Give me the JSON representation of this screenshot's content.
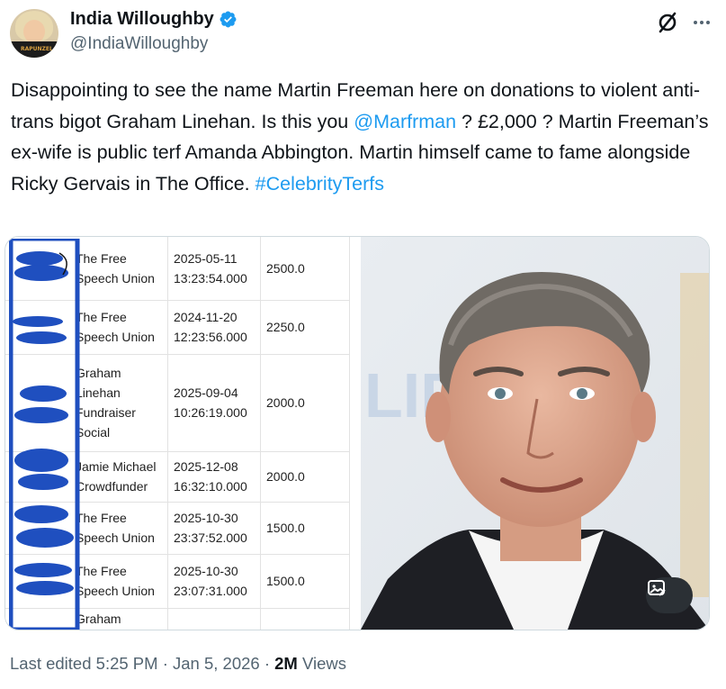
{
  "author": {
    "name": "India Willoughby",
    "handle": "@IndiaWilloughby",
    "verified": true,
    "avatar_shirt_text": "RAPUNZEL"
  },
  "icons": {
    "top_right": [
      "grok-icon",
      "more-icon"
    ],
    "media": [
      "alt-text-icon"
    ]
  },
  "tweet": {
    "part1": "Disappointing to see the name Martin Freeman here on donations to violent anti-trans bigot Graham Linehan. Is this you ",
    "mention": "@Marfrman",
    "part2": " ? £2,000 ? Martin Freeman’s ex-wife is public terf Amanda Abbington. Martin himself came to fame alongside Ricky Gervais in The Office. ",
    "hashtag": "#CelebrityTerfs"
  },
  "donations": [
    {
      "recipient": [
        "The Free",
        "Speech Union"
      ],
      "date": "2025-05-11",
      "time": "13:23:54.000",
      "amount": "2500.0"
    },
    {
      "recipient": [
        "The Free",
        "Speech Union"
      ],
      "date": "2024-11-20",
      "time": "12:23:56.000",
      "amount": "2250.0"
    },
    {
      "recipient": [
        "Graham",
        "Linehan",
        "Fundraiser",
        "Social"
      ],
      "date": "2025-09-04",
      "time": "10:26:19.000",
      "amount": "2000.0"
    },
    {
      "recipient": [
        "Jamie Michael",
        "Crowdfunder"
      ],
      "date": "2025-12-08",
      "time": "16:32:10.000",
      "amount": "2000.0"
    },
    {
      "recipient": [
        "The Free",
        "Speech Union"
      ],
      "date": "2025-10-30",
      "time": "23:37:52.000",
      "amount": "1500.0"
    },
    {
      "recipient": [
        "The Free",
        "Speech Union"
      ],
      "date": "2025-10-30",
      "time": "23:07:31.000",
      "amount": "1500.0"
    },
    {
      "recipient": [
        "Graham"
      ],
      "date": "",
      "time": "",
      "amount": ""
    }
  ],
  "photo_bg_text": "LIP",
  "footer": {
    "edited": "Last edited 5:25 PM · Jan 5, 2026 · ",
    "views_count": "2M",
    "views_label": " Views"
  },
  "colors": {
    "link": "#1d9bf0",
    "verified": "#1d9bf0",
    "redaction": "#1f4fbf",
    "muted": "#536471"
  }
}
